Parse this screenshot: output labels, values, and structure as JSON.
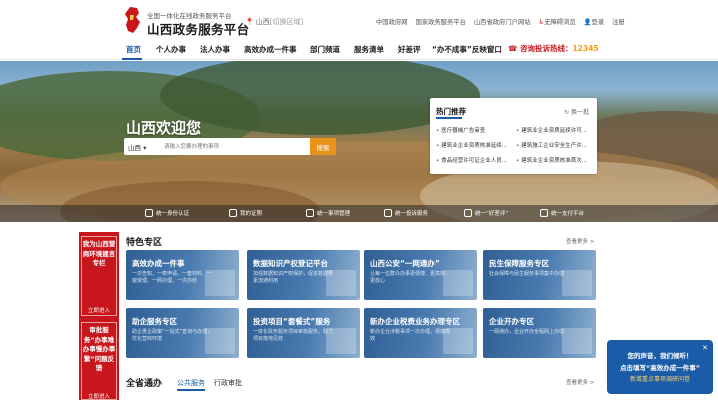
{
  "header": {
    "logo_sub": "全国一体化在线政务服务平台",
    "logo_title": "山西政务服务平台",
    "region": "山西",
    "region_switch": "[切换区域]",
    "top_links": [
      "中国政府网",
      "国家政务服务平台",
      "山西省政府门户网站",
      "无障碍浏览",
      "登录",
      "注册"
    ]
  },
  "nav": {
    "items": [
      "首页",
      "个人办事",
      "法人办事",
      "高效办成一件事",
      "部门频道",
      "服务清单",
      "好差评",
      "“办不成事”反映窗口"
    ],
    "hotline_label": "咨询投诉热线：",
    "hotline_number": "12345"
  },
  "banner": {
    "welcome": "山西欢迎您",
    "search_select": "山西",
    "search_placeholder": "请输入您要办理的事项",
    "search_button": "搜索"
  },
  "hot": {
    "title": "热门推荐",
    "refresh": "换一批",
    "items": [
      "医疗器械广告审查",
      "建筑业企业资质延续许可...",
      "建筑业企业资质核准延续...",
      "建筑施工企业安全生产许...",
      "食品经营许可证企业人员...",
      "建筑业企业资质核准首次..."
    ]
  },
  "quickbar": [
    "统一身份认证",
    "我的证照",
    "统一事项管理",
    "统一投诉服务",
    "统一“好差评”",
    "统一支付平台"
  ],
  "promo": {
    "box1_text": "我为山西营商环境建言专栏",
    "box1_more": "立即进入",
    "box2_text": "审批服务“办事难办事慢办事繁”问题反馈",
    "box2_more": "立即进入"
  },
  "special": {
    "title": "特色专区",
    "more": "查看更多 >",
    "cards": [
      {
        "title": "高效办成一件事",
        "desc": "一次告知、一表申请、一套材料、一窗受理、一网办理、一次办结"
      },
      {
        "title": "数据知识产权登记平台",
        "desc": "加强数据知识产权保护，促进数据要素流通利用"
      },
      {
        "title": "山西公安“一网通办”",
        "desc": "让每一位群众办事更便捷、更高效、更放心"
      },
      {
        "title": "民生保障服务专区",
        "desc": "社会保障与民生服务事项集中办理"
      },
      {
        "title": "助企服务专区",
        "desc": "助企惠企政策“一站式”查询与办理，优化营商环境"
      },
      {
        "title": "投资项目“套餐式”服务",
        "desc": "一体化政务服务项目审批服务，助力项目落地见效"
      },
      {
        "title": "新办企业税费业务办理专区",
        "desc": "新办企业涉税事项一次办理，便捷高效"
      },
      {
        "title": "企业开办专区",
        "desc": "一网通办，企业开办全程网上办理"
      }
    ]
  },
  "section2": {
    "title": "全省通办",
    "tabs": [
      "公共服务",
      "行政审批"
    ],
    "more": "查看更多 >"
  },
  "float": {
    "line1": "您的声音，我们倾听！",
    "line2": "点击填写“高效办成一件事”",
    "line3": "新增重点事项调研问卷",
    "close": "✕"
  },
  "colors": {
    "brand_red": "#c8161d",
    "brand_blue": "#1a5ca8",
    "accent_orange": "#e8941a"
  }
}
